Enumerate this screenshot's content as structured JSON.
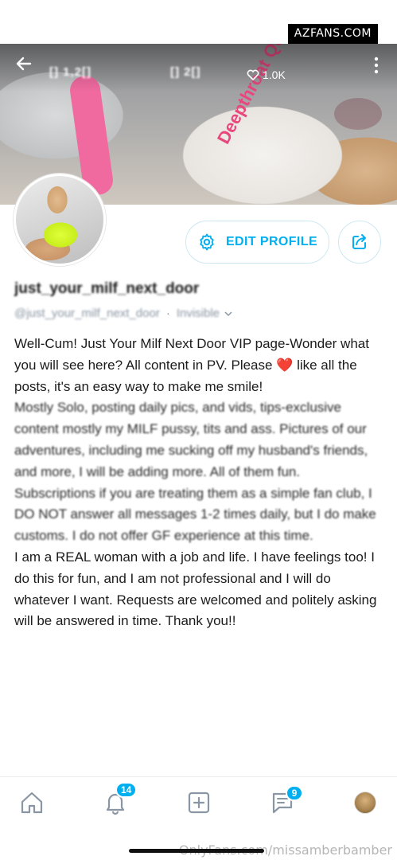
{
  "watermark_top": "AZFANS.COM",
  "cover": {
    "likes_count": "1.0K",
    "shirt_text": "Deepthroat Queen",
    "blurred_stats_left": "[] 1,2[]",
    "blurred_stats_right": "[] 2[]"
  },
  "profile": {
    "edit_label": "EDIT PROFILE",
    "display_name": "just_your_milf_next_door",
    "handle": "@just_your_milf_next_door",
    "status": "Invisible"
  },
  "bio": [
    "Well-Cum! Just Your Milf Next Door VIP page-Wonder what you will see here? All content in PV. Please ❤️ like all the posts, it's an easy way to make me smile!",
    "Mostly Solo, posting daily pics, and vids, tips-exclusive content mostly my MILF pussy, tits and ass. Pictures of our adventures, including me sucking off my husband's friends, and more, I will be adding more. All of them fun.",
    "Subscriptions if you are treating them as a simple fan club, I DO NOT answer all messages 1-2 times daily, but I do make customs. I do not offer GF experience at this time.",
    "I am a REAL woman with a job and life. I have feelings too! I do this for fun, and I am not professional and I will do whatever I want. Requests are welcomed and politely asking will be answered in time. Thank you!!"
  ],
  "tabs": {
    "notifications_badge": "14",
    "messages_badge": "9"
  },
  "watermark_bottom": "OnlyFans.com/missamberbamber",
  "colors": {
    "accent": "#00aff0",
    "text": "#1b1b1b",
    "muted": "#8a96a3"
  }
}
